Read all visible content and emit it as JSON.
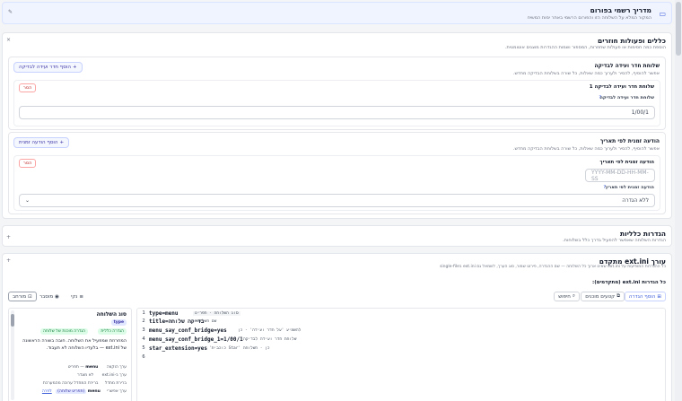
{
  "guide": {
    "title": "מדריך רשמי בפורום",
    "subtitle": "המקור המלא על השלוחה הזו והפורום הרשמי באתר ימות המשיח"
  },
  "rules": {
    "title": "כללים ופעולות חוזרים",
    "subtitle": "הוספת כמה חסימות או פעולות שחוזרות, המספור ושמות ההגדרות מוצגים אוטומטית."
  },
  "room": {
    "title": "שלוחת חדר ועידה לבדיקה",
    "subtitle": "אפשר להוסיף, להסיר ולערוך כמה שאלות, כל שורה בשלוחת הבדיקה מחדש.",
    "add_label": "הוסף חדר ועידה לבדיקה",
    "item_title": "שלוחת חדר ועידה לבדיקה 1",
    "delete_label": "הסר",
    "field_label": "שלוחת חדר ועידה לבדיקה",
    "help": "?",
    "value": "1/00/1"
  },
  "timed": {
    "title": "הודעה זמנית לפי תאריך",
    "subtitle": "אפשר להוסיף, להסיר ולערוך כמה שאלות, כל שורה בשלוחת הבדיקה מחדש.",
    "add_label": "הוסף הודעה זמנית",
    "item_title": "הודעה זמנית לפי תאריך",
    "delete_label": "הסר",
    "date_placeholder": "YYYY-MM-DD-HH-MM-SS",
    "field_label": "הודעה זמנית לפי תאריך",
    "help": "?",
    "select_value": "ללא הגדרה"
  },
  "general": {
    "title": "הגדרות כלליות",
    "subtitle": "הגדרות השלוחה שאפשר להפעיל בדרך כלל בשלוחות."
  },
  "editor_section": {
    "title": "עורך ext.ini מתקדם",
    "subtitle": "כל ההגדרות המופיעות על ext.ini שאינו ארוך כל השלוחה — שם ההגדרה, פירוט שמור, סוג הערך, לשמאל גם ext.ini בsingle-file",
    "all_settings": "כל הגדרות ext.ini (מתקדמים):"
  },
  "toolbar": {
    "add_setting": "הוסף הגדרה",
    "snippets": "קטעים מוכנים",
    "search": "חיפוש",
    "clean": "נקי",
    "compact": "מוסבר",
    "wrap": "מורחב"
  },
  "code_lines": [
    {
      "num": "1",
      "code": "type=menu",
      "anno": "סוג השלוחה · תפריט"
    },
    {
      "num": "2",
      "code": "title=בדיקה שלוחה",
      "anno": "שם השלוחה"
    },
    {
      "num": "3",
      "code": "menu_say_conf_bridge=yes",
      "anno": "להשמיע 'על חדר ועידה' - כן"
    },
    {
      "num": "4",
      "code": "menu_say_conf_bridge_1=1/00/1",
      "anno": "שלוחת חדר ועידה לבדיקה"
    },
    {
      "num": "5",
      "code": "star_extension=yes",
      "anno": "כן · השלוחה 'Star כוכבית'"
    },
    {
      "num": "6",
      "code": "",
      "anno": ""
    }
  ],
  "side_panel": {
    "title": "סוג השלוחה",
    "type_badge": "type",
    "tag1": "הגדרה כללית",
    "tag2": "הגדרה מוכנת של שלוחה",
    "description": "המחרוזת שמפעיל את השלוחה. חובה בשורה הראשונה של ext.ini — בלעדיו השלוחה לא תעבוד.",
    "rows": [
      {
        "key": "ערך הוקצה",
        "val": "menu",
        "extra": "— תפריט"
      },
      {
        "key": "ערך ב-ext.ini",
        "val": "לא מוגדר",
        "extra": ""
      },
      {
        "key": "ברירת מחדל",
        "val": "ברירת המחדל ערוכה מהמערכת",
        "extra": ""
      },
      {
        "key": "ערך אפשרי",
        "val": "menu",
        "extra": "(תפריט שלוחה)"
      }
    ],
    "more_link": "לפרה"
  },
  "colors": {
    "accent": "#3b5bdb",
    "delete": "#b91c1c",
    "editor_bg": "#fafafa"
  }
}
